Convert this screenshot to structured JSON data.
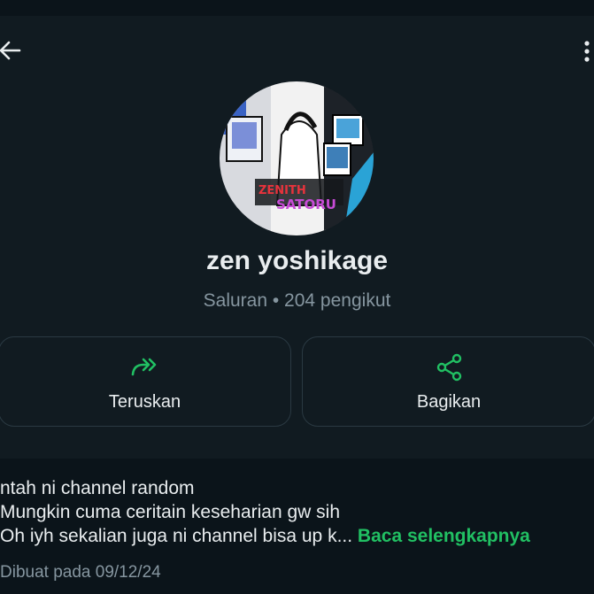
{
  "channel": {
    "name": "zen yoshikage",
    "subtitle": "Saluran • 204 pengikut",
    "avatar_text_top": "ZENITH",
    "avatar_text_bottom": "SATORU"
  },
  "actions": {
    "forward_label": "Teruskan",
    "share_label": "Bagikan"
  },
  "description": {
    "lines": [
      "ntah ni channel random",
      "Mungkin cuma ceritain keseharian gw sih",
      "Oh iyh sekalian juga ni channel bisa up k..."
    ],
    "read_more": "Baca selengkapnya"
  },
  "created": "Dibuat pada 09/12/24",
  "colors": {
    "accent": "#21c063",
    "background": "#0b141a",
    "panel": "#111b21",
    "secondary_text": "#8696a0"
  },
  "icons": [
    "back-arrow-icon",
    "more-vert-icon",
    "forward-icon",
    "share-icon"
  ]
}
